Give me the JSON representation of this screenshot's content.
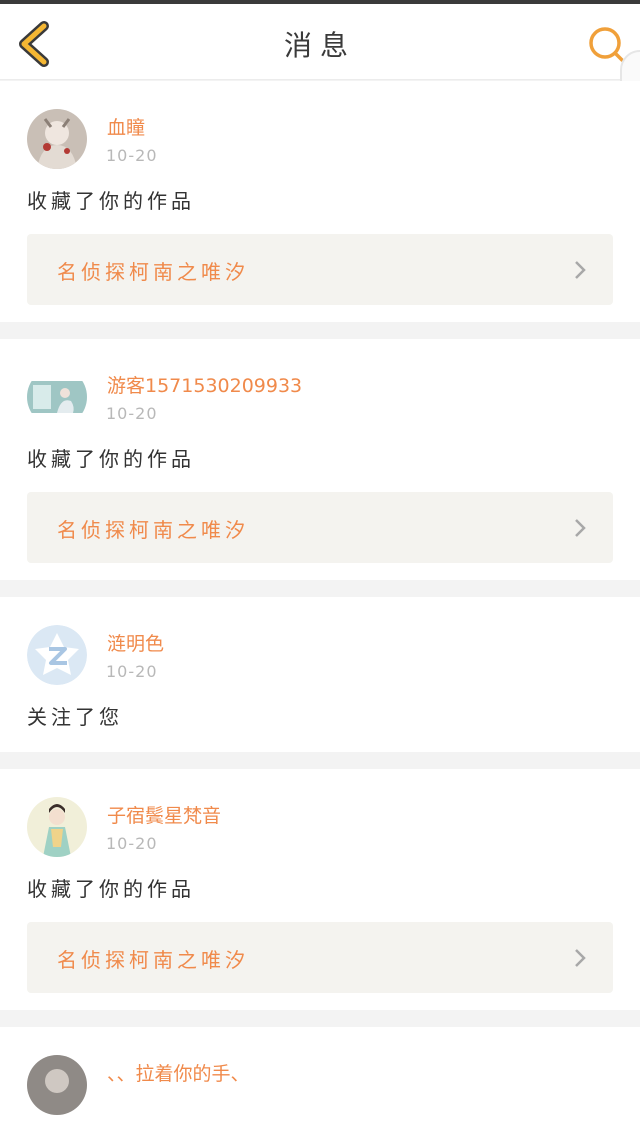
{
  "header": {
    "title": "消息",
    "back_icon": "chevron-left-icon",
    "search_icon": "search-icon",
    "accent_color": "#f0a03a"
  },
  "messages": [
    {
      "username": "血瞳",
      "time": "10-20",
      "action": "收藏了你的作品",
      "work_title": "名侦探柯南之唯汐"
    },
    {
      "username": "游客1571530209933",
      "time": "10-20",
      "action": "收藏了你的作品",
      "work_title": "名侦探柯南之唯汐"
    },
    {
      "username": "涟明色",
      "time": "10-20",
      "action": "关注了您"
    },
    {
      "username": "子宿鬓星梵音",
      "time": "10-20",
      "action": "收藏了你的作品",
      "work_title": "名侦探柯南之唯汐"
    },
    {
      "username": "、、拉着你的手、"
    }
  ],
  "colors": {
    "username": "#f08a4b",
    "work_title": "#f08a4b",
    "time": "#b8b8b8",
    "card_bg": "#ffffff",
    "link_bg": "#f4f3ef"
  }
}
